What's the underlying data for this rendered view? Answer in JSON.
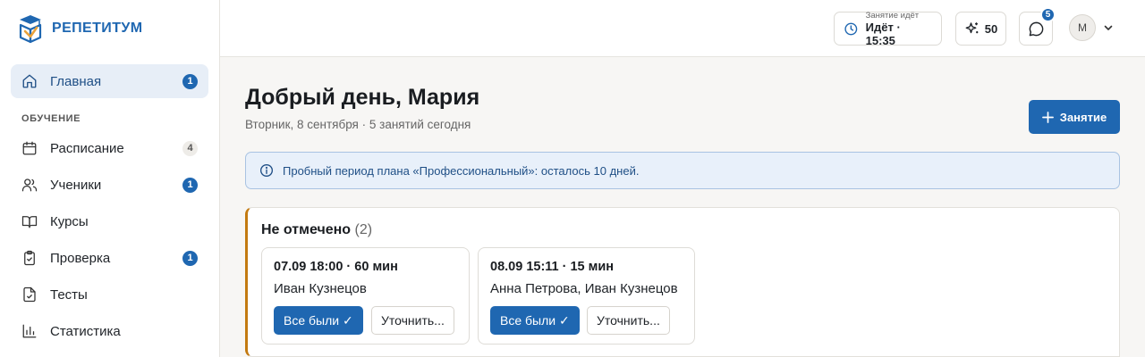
{
  "brand": {
    "name": "РЕПЕТИТУМ"
  },
  "sidebar": {
    "items": [
      {
        "label": "Главная",
        "badge": "1",
        "icon": "home-icon"
      }
    ],
    "section_label": "ОБУЧЕНИЕ",
    "learning_items": [
      {
        "label": "Расписание",
        "badge": "4",
        "icon": "calendar-icon"
      },
      {
        "label": "Ученики",
        "badge": "1",
        "icon": "users-icon"
      },
      {
        "label": "Курсы",
        "badge": "",
        "icon": "book-icon"
      },
      {
        "label": "Проверка",
        "badge": "1",
        "icon": "clipboard-check-icon"
      },
      {
        "label": "Тесты",
        "badge": "",
        "icon": "file-check-icon"
      },
      {
        "label": "Статистика",
        "badge": "",
        "icon": "bar-chart-icon"
      }
    ]
  },
  "topbar": {
    "lesson_status_small": "Занятие идёт",
    "lesson_status_big": "Идёт · 15:35",
    "points": "50",
    "messages_badge": "5",
    "avatar_initial": "М"
  },
  "main": {
    "greeting": "Добрый день, Мария",
    "subline": "Вторник, 8 сентября · 5 занятий сегодня",
    "add_button": "Занятие",
    "notice": "Пробный период плана «Профессиональный»: осталось 10 дней.",
    "unmarked": {
      "title": "Не отмечено",
      "count": "(2)",
      "lessons": [
        {
          "time": "07.09 18:00 · 60 мин",
          "people": "Иван Кузнецов",
          "confirm": "Все были ✓",
          "clarify": "Уточнить..."
        },
        {
          "time": "08.09 15:11 · 15 мин",
          "people": "Анна Петрова, Иван Кузнецов",
          "confirm": "Все были ✓",
          "clarify": "Уточнить..."
        }
      ]
    }
  },
  "colors": {
    "accent": "#1f67b1",
    "warning_stripe": "#c37a11",
    "notice_bg": "#e8f0fa"
  }
}
